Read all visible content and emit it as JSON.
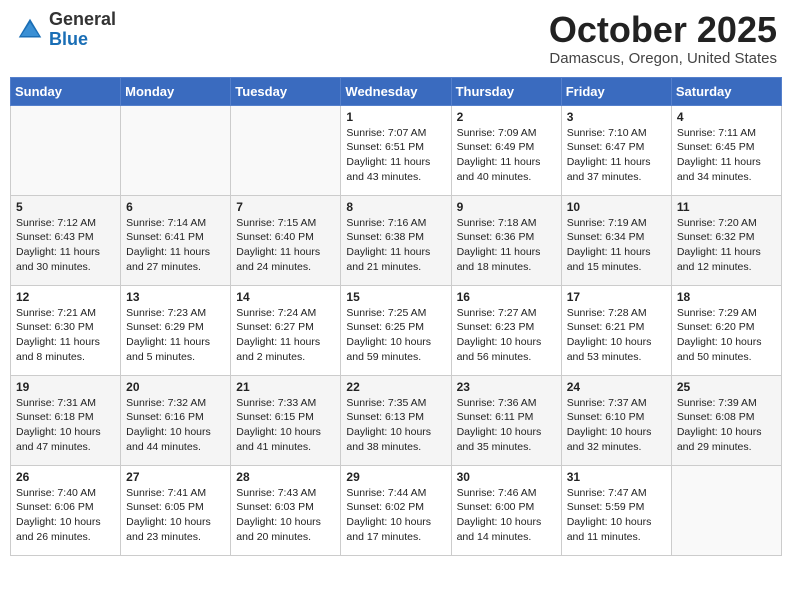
{
  "header": {
    "logo_general": "General",
    "logo_blue": "Blue",
    "month": "October 2025",
    "location": "Damascus, Oregon, United States"
  },
  "days_of_week": [
    "Sunday",
    "Monday",
    "Tuesday",
    "Wednesday",
    "Thursday",
    "Friday",
    "Saturday"
  ],
  "weeks": [
    [
      {
        "day": "",
        "info": ""
      },
      {
        "day": "",
        "info": ""
      },
      {
        "day": "",
        "info": ""
      },
      {
        "day": "1",
        "info": "Sunrise: 7:07 AM\nSunset: 6:51 PM\nDaylight: 11 hours and 43 minutes."
      },
      {
        "day": "2",
        "info": "Sunrise: 7:09 AM\nSunset: 6:49 PM\nDaylight: 11 hours and 40 minutes."
      },
      {
        "day": "3",
        "info": "Sunrise: 7:10 AM\nSunset: 6:47 PM\nDaylight: 11 hours and 37 minutes."
      },
      {
        "day": "4",
        "info": "Sunrise: 7:11 AM\nSunset: 6:45 PM\nDaylight: 11 hours and 34 minutes."
      }
    ],
    [
      {
        "day": "5",
        "info": "Sunrise: 7:12 AM\nSunset: 6:43 PM\nDaylight: 11 hours and 30 minutes."
      },
      {
        "day": "6",
        "info": "Sunrise: 7:14 AM\nSunset: 6:41 PM\nDaylight: 11 hours and 27 minutes."
      },
      {
        "day": "7",
        "info": "Sunrise: 7:15 AM\nSunset: 6:40 PM\nDaylight: 11 hours and 24 minutes."
      },
      {
        "day": "8",
        "info": "Sunrise: 7:16 AM\nSunset: 6:38 PM\nDaylight: 11 hours and 21 minutes."
      },
      {
        "day": "9",
        "info": "Sunrise: 7:18 AM\nSunset: 6:36 PM\nDaylight: 11 hours and 18 minutes."
      },
      {
        "day": "10",
        "info": "Sunrise: 7:19 AM\nSunset: 6:34 PM\nDaylight: 11 hours and 15 minutes."
      },
      {
        "day": "11",
        "info": "Sunrise: 7:20 AM\nSunset: 6:32 PM\nDaylight: 11 hours and 12 minutes."
      }
    ],
    [
      {
        "day": "12",
        "info": "Sunrise: 7:21 AM\nSunset: 6:30 PM\nDaylight: 11 hours and 8 minutes."
      },
      {
        "day": "13",
        "info": "Sunrise: 7:23 AM\nSunset: 6:29 PM\nDaylight: 11 hours and 5 minutes."
      },
      {
        "day": "14",
        "info": "Sunrise: 7:24 AM\nSunset: 6:27 PM\nDaylight: 11 hours and 2 minutes."
      },
      {
        "day": "15",
        "info": "Sunrise: 7:25 AM\nSunset: 6:25 PM\nDaylight: 10 hours and 59 minutes."
      },
      {
        "day": "16",
        "info": "Sunrise: 7:27 AM\nSunset: 6:23 PM\nDaylight: 10 hours and 56 minutes."
      },
      {
        "day": "17",
        "info": "Sunrise: 7:28 AM\nSunset: 6:21 PM\nDaylight: 10 hours and 53 minutes."
      },
      {
        "day": "18",
        "info": "Sunrise: 7:29 AM\nSunset: 6:20 PM\nDaylight: 10 hours and 50 minutes."
      }
    ],
    [
      {
        "day": "19",
        "info": "Sunrise: 7:31 AM\nSunset: 6:18 PM\nDaylight: 10 hours and 47 minutes."
      },
      {
        "day": "20",
        "info": "Sunrise: 7:32 AM\nSunset: 6:16 PM\nDaylight: 10 hours and 44 minutes."
      },
      {
        "day": "21",
        "info": "Sunrise: 7:33 AM\nSunset: 6:15 PM\nDaylight: 10 hours and 41 minutes."
      },
      {
        "day": "22",
        "info": "Sunrise: 7:35 AM\nSunset: 6:13 PM\nDaylight: 10 hours and 38 minutes."
      },
      {
        "day": "23",
        "info": "Sunrise: 7:36 AM\nSunset: 6:11 PM\nDaylight: 10 hours and 35 minutes."
      },
      {
        "day": "24",
        "info": "Sunrise: 7:37 AM\nSunset: 6:10 PM\nDaylight: 10 hours and 32 minutes."
      },
      {
        "day": "25",
        "info": "Sunrise: 7:39 AM\nSunset: 6:08 PM\nDaylight: 10 hours and 29 minutes."
      }
    ],
    [
      {
        "day": "26",
        "info": "Sunrise: 7:40 AM\nSunset: 6:06 PM\nDaylight: 10 hours and 26 minutes."
      },
      {
        "day": "27",
        "info": "Sunrise: 7:41 AM\nSunset: 6:05 PM\nDaylight: 10 hours and 23 minutes."
      },
      {
        "day": "28",
        "info": "Sunrise: 7:43 AM\nSunset: 6:03 PM\nDaylight: 10 hours and 20 minutes."
      },
      {
        "day": "29",
        "info": "Sunrise: 7:44 AM\nSunset: 6:02 PM\nDaylight: 10 hours and 17 minutes."
      },
      {
        "day": "30",
        "info": "Sunrise: 7:46 AM\nSunset: 6:00 PM\nDaylight: 10 hours and 14 minutes."
      },
      {
        "day": "31",
        "info": "Sunrise: 7:47 AM\nSunset: 5:59 PM\nDaylight: 10 hours and 11 minutes."
      },
      {
        "day": "",
        "info": ""
      }
    ]
  ]
}
